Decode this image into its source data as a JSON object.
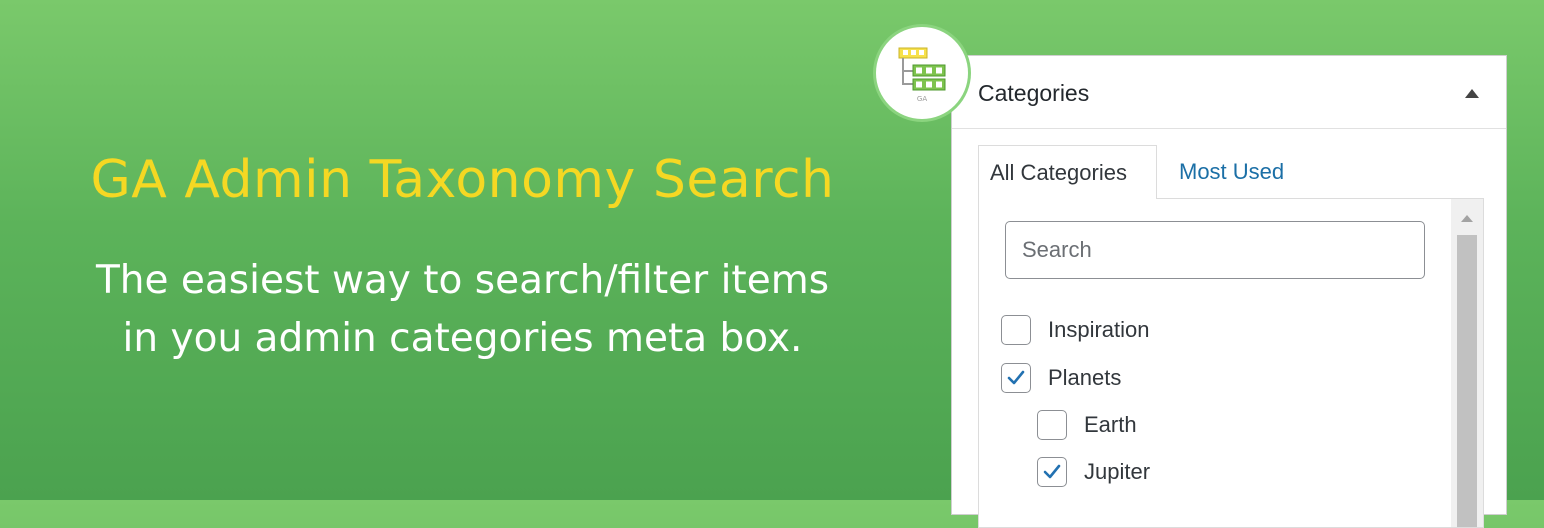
{
  "hero": {
    "title": "GA Admin Taxonomy Search",
    "subtitle_line1": "The easiest way to search/filter items",
    "subtitle_line2": "in you admin categories meta box."
  },
  "logo": {
    "icon": "taxonomy-tree-icon",
    "text": "GA"
  },
  "panel": {
    "title": "Categories",
    "collapse_icon": "triangle-up-icon",
    "tabs": [
      {
        "label": "All Categories",
        "active": true
      },
      {
        "label": "Most Used",
        "active": false
      }
    ],
    "search": {
      "placeholder": "Search",
      "value": ""
    },
    "categories": [
      {
        "label": "Inspiration",
        "checked": false,
        "level": 0
      },
      {
        "label": "Planets",
        "checked": true,
        "level": 0
      },
      {
        "label": "Earth",
        "checked": false,
        "level": 1
      },
      {
        "label": "Jupiter",
        "checked": true,
        "level": 1
      }
    ]
  },
  "colors": {
    "title_yellow": "#f5d823",
    "link_blue": "#1b6fa6",
    "check_blue": "#2271b1",
    "green_bg": "#5cb35a"
  }
}
